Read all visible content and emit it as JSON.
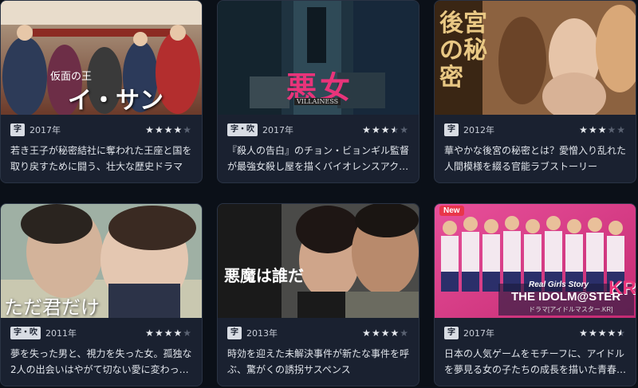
{
  "cards": [
    {
      "thumb_title": "イ・サン",
      "thumb_subtitle": "仮面の王",
      "badge": "字",
      "year": "2017年",
      "rating": 4,
      "desc": "若き王子が秘密結社に奪われた王座と国を取り戻すために闘う、壮大な歴史ドラマ"
    },
    {
      "thumb_title": "悪女",
      "thumb_subtitle": "VILLAINESS",
      "badge": "字・吹",
      "year": "2017年",
      "rating": 3.5,
      "desc": "『殺人の告白』のチョン・ビョンギル監督が最強女殺し屋を描くバイオレンスアク…"
    },
    {
      "thumb_title": "後宮の秘密",
      "badge": "字",
      "year": "2012年",
      "rating": 3,
      "desc": "華やかな後宮の秘密とは？愛憎入り乱れた人間模様を綴る官能ラブストーリー"
    },
    {
      "thumb_title": "ただ君だけ",
      "badge": "字・吹",
      "year": "2011年",
      "rating": 4,
      "desc": "夢を失った男と、視力を失った女。孤独な2人の出会いはやがて切ない愛に変わっ…"
    },
    {
      "thumb_title": "悪魔は誰だ",
      "badge": "字",
      "year": "2013年",
      "rating": 4,
      "desc": "時効を迎えた未解決事件が新たな事件を呼ぶ、驚がくの誘拐サスペンス"
    },
    {
      "thumb_title": "THE IDOLM@STER",
      "thumb_kr": "KR",
      "thumb_subtitle": "Real Girls Story",
      "thumb_caption": "ドラマ[アイドルマスター.KR]",
      "new_label": "New",
      "badge": "字",
      "year": "2017年",
      "rating": 4.5,
      "desc": "日本の人気ゲームをモチーフに、アイドルを夢見る女の子たちの成長を描いた青春…"
    }
  ]
}
